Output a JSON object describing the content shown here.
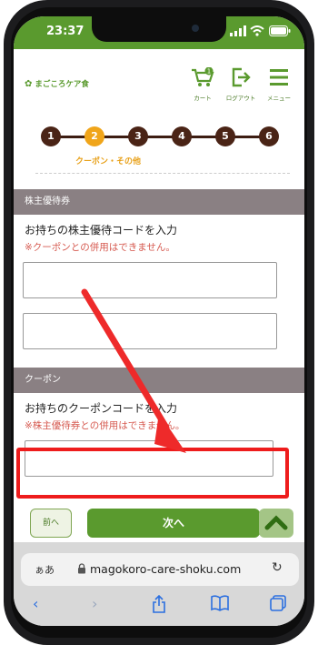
{
  "status": {
    "time": "23:37"
  },
  "header": {
    "logo_text": "まごころケア食",
    "cart_label": "カート",
    "cart_badge": "1",
    "logout_label": "ログアウト",
    "menu_label": "メニュー"
  },
  "steps": {
    "items": [
      "1",
      "2",
      "3",
      "4",
      "5",
      "6"
    ],
    "active": "2",
    "caption": "クーポン・その他"
  },
  "shareholder": {
    "heading": "株主優待券",
    "instruction": "お持ちの株主優待コードを入力",
    "warning": "※クーポンとの併用はできません。",
    "field1_value": "",
    "field2_value": ""
  },
  "coupon": {
    "heading": "クーポン",
    "instruction": "お持ちのクーポンコードを入力",
    "warning": "※株主優待券との併用はできません。",
    "field_value": ""
  },
  "buttons": {
    "prev": "前へ",
    "next": "次へ"
  },
  "browser": {
    "text_size": "ぁあ",
    "url": "magokoro-care-shoku.com"
  },
  "colors": {
    "brand_green": "#5a9a2e",
    "step_brown": "#4a2416",
    "step_active": "#f0a51a",
    "warning_red": "#d65a50",
    "highlight_red": "#ee1c1c"
  }
}
